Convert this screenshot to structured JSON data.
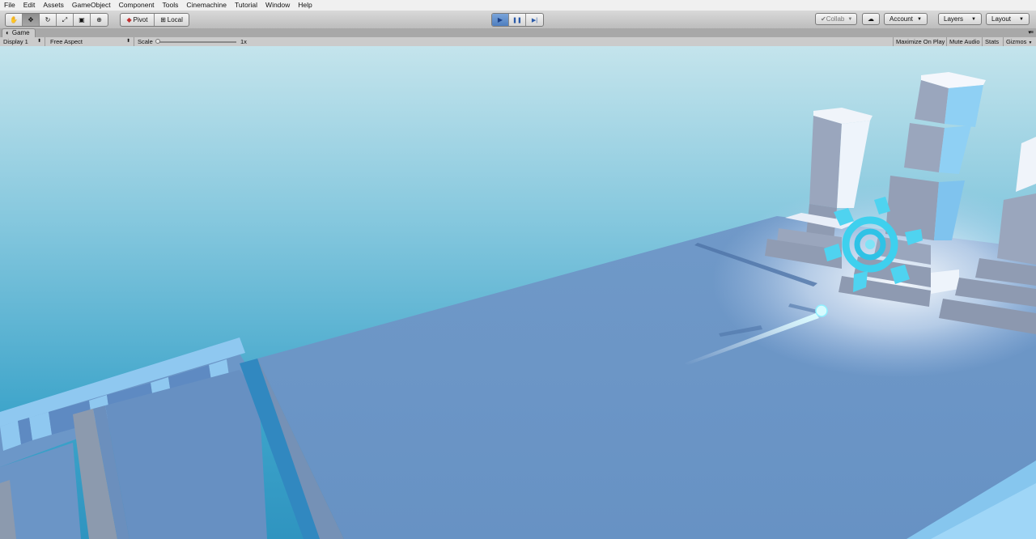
{
  "menu": [
    "File",
    "Edit",
    "Assets",
    "GameObject",
    "Component",
    "Tools",
    "Cinemachine",
    "Tutorial",
    "Window",
    "Help"
  ],
  "toolbar": {
    "tools": [
      {
        "name": "hand-tool",
        "glyph": "✋"
      },
      {
        "name": "move-tool",
        "glyph": "✥"
      },
      {
        "name": "rotate-tool",
        "glyph": "↻"
      },
      {
        "name": "scale-tool",
        "glyph": "⤢"
      },
      {
        "name": "rect-tool",
        "glyph": "▣"
      },
      {
        "name": "transform-tool",
        "glyph": "⊕"
      }
    ],
    "pivot_label": "Pivot",
    "local_label": "Local",
    "play_glyph": "▶",
    "pause_glyph": "❚❚",
    "step_glyph": "▶|",
    "collab_label": "Collab",
    "account_label": "Account",
    "layers_label": "Layers",
    "layout_label": "Layout"
  },
  "tab": {
    "title": "Game"
  },
  "gamebar": {
    "display": "Display 1",
    "aspect": "Free Aspect",
    "scale_label": "Scale",
    "scale_value": "1x",
    "maximize_label": "Maximize On Play",
    "mute_label": "Mute Audio",
    "stats_label": "Stats",
    "gizmos_label": "Gizmos"
  },
  "colors": {
    "sky_top": "#bfe2ea",
    "sky_bottom": "#3ba3c9",
    "floor": "#6a96c6",
    "accent": "#4fd7f0",
    "play_active": "#4f7fbf"
  }
}
